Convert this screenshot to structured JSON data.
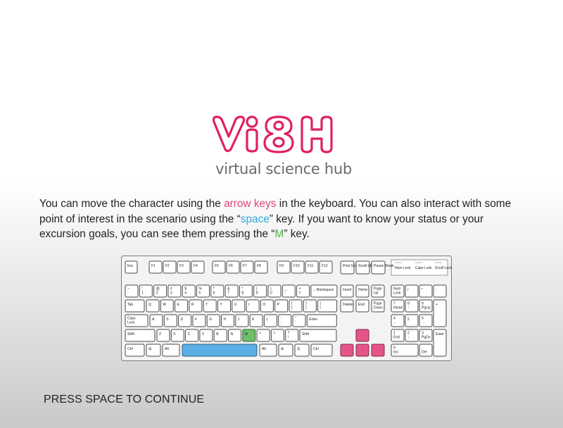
{
  "logo": {
    "text": "ViSH",
    "color": "#e0215f"
  },
  "subtitle": "virtual science hub",
  "instructions": {
    "part1": "You can move the character using the ",
    "arrow_keys": "arrow keys",
    "part2": " in the keyboard. You can also interact with some point of interest in the scenario using the “",
    "space": "space",
    "part3": "” key. If you want to know your status or your excursion goals, you can see them pressing the “",
    "m": "M",
    "part4": "” key."
  },
  "keyboard": {
    "highlight_colors": {
      "arrows": "#e8548a",
      "space": "#5aaee3",
      "m": "#6fbf6a"
    },
    "keys": {
      "esc": "Esc",
      "f1": "F1",
      "f2": "F2",
      "f3": "F3",
      "f4": "F4",
      "f5": "F5",
      "f6": "F6",
      "f7": "F7",
      "f8": "F8",
      "f9": "F9",
      "f10": "F10",
      "f11": "F11",
      "f12": "F12",
      "print": "Print Screen SysRq",
      "scroll": "Scroll Lock",
      "pause": "Pause Break",
      "num_lock_ind": "Num Lock",
      "caps_lock_ind": "Caps Lock",
      "scroll_lock_ind": "Scroll Lock",
      "tilde": "~ `",
      "n1": "! 1",
      "n2": "@ 2",
      "n3": "# 3",
      "n4": "$ 4",
      "n5": "% 5",
      "n6": "^ 6",
      "n7": "& 7",
      "n8": "* 8",
      "n9": "( 9",
      "n0": ") 0",
      "minus": "_ -",
      "plus": "+ =",
      "backspace": "←Backspace",
      "tab": "Tab",
      "q": "Q",
      "w": "W",
      "e": "E",
      "r": "R",
      "t": "T",
      "y": "Y",
      "u": "U",
      "i": "I",
      "o": "O",
      "p": "P",
      "lbrace": "{ [",
      "rbrace": "} ]",
      "pipe": "| \\",
      "caps": "Caps Lock",
      "a": "A",
      "s": "S",
      "d": "D",
      "f": "F",
      "g": "G",
      "h": "H",
      "j": "J",
      "k": "K",
      "l": "L",
      "colon": ": ;",
      "quote": "\" '",
      "enter": "Enter",
      "lshift": "Shift",
      "z": "Z",
      "x": "X",
      "c": "C",
      "v": "V",
      "b": "B",
      "n": "N",
      "m": "M",
      "comma": "< ,",
      "period": "> .",
      "slash": "? /",
      "rshift": "Shift",
      "lctrl": "Ctrl",
      "lwin": "⊞",
      "lalt": "Alt",
      "space": "",
      "ralt": "Alt",
      "rwin": "⊞",
      "menu": "☰",
      "rctrl": "Ctrl",
      "insert": "Insert",
      "home": "Home",
      "pgup": "Page Up",
      "delete": "Delete",
      "end": "End",
      "pgdn": "Page Down",
      "up": "↑",
      "left": "←",
      "down": "↓",
      "right": "→",
      "numlock": "Num Lock",
      "numdiv": "/",
      "nummul": "*",
      "numsub": "-",
      "num7": "7 Home",
      "num8": "8 ↑",
      "num9": "9 PgUp",
      "numadd": "+",
      "num4": "4 ←",
      "num5": "5",
      "num6": "6 →",
      "num1": "1 End",
      "num2": "2 ↓",
      "num3": "3 PgDn",
      "numenter": "Enter",
      "num0": "0 Ins",
      "numdel": ". Del"
    }
  },
  "continue_prompt": "PRESS SPACE TO CONTINUE"
}
